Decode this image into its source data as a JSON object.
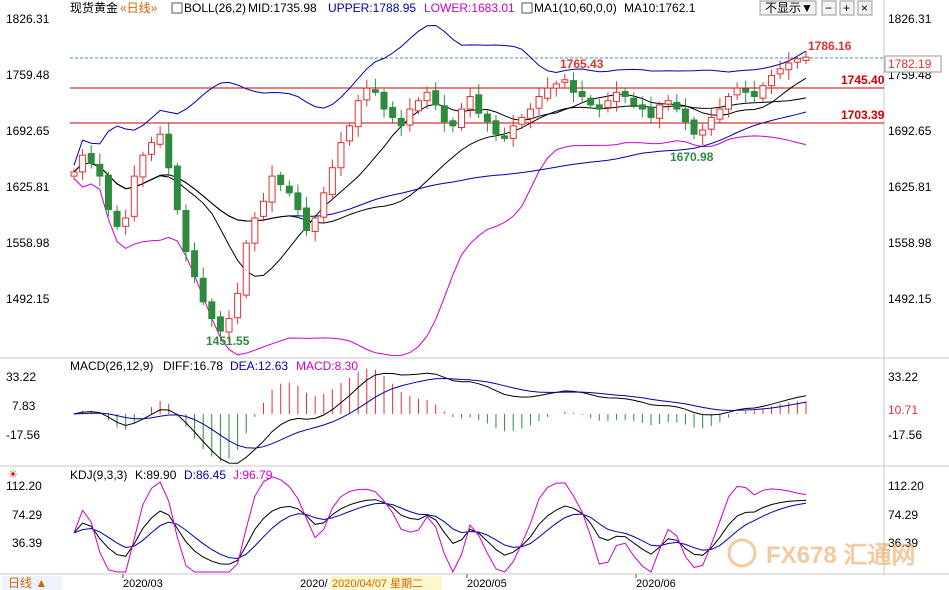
{
  "header": {
    "symbol": "现货黄金",
    "period": "«日线»",
    "boll_label": "BOLL(26,2)",
    "boll_mid": "MID:1735.98",
    "boll_upper": "UPPER:1788.95",
    "boll_lower": "LOWER:1683.01",
    "ma_label": "MA1(10,60,0,0)",
    "ma10": "MA10:1762.1",
    "hide_button": "不显示▼"
  },
  "price_axis": {
    "ticks": [
      "1826.31",
      "1759.48",
      "1692.65",
      "1625.81",
      "1558.98",
      "1492.15"
    ],
    "current_price": "1782.19"
  },
  "annotations": {
    "high_label": "1786.16",
    "peak_label": "1765.43",
    "resistance_1": "1745.40",
    "resistance_2": "1703.39",
    "trough_label": "1670.98",
    "low_label": "1451.55"
  },
  "macd": {
    "title": "MACD(26,12,9)",
    "diff": "DIFF:16.78",
    "dea": "DEA:12.63",
    "macd": "MACD:8.30",
    "ticks": [
      "33.22",
      "7.83",
      "-17.56"
    ],
    "current": "10.71"
  },
  "kdj": {
    "title": "KDJ(9,3,3)",
    "k": "K:89.90",
    "d": "D:86.45",
    "j": "J:96.79",
    "ticks": [
      "112.20",
      "74.29",
      "36.39"
    ]
  },
  "bottom_bar": {
    "period_button": "日线 ▲",
    "dates": [
      "2020/03",
      "2020/",
      "2020/04/07 星期二",
      "2020/05",
      "2020/06"
    ],
    "watermark": "FX678 汇通网"
  },
  "colors": {
    "up": "#e03131",
    "down": "#2e8b3e",
    "mid": "#000000",
    "upper": "#0000aa",
    "lower": "#cc00cc",
    "ma10": "#000000",
    "ma60": "#0000aa",
    "resistance": "#cc0000",
    "diff": "#000000",
    "dea": "#0000aa",
    "k": "#000000",
    "d": "#0000aa",
    "j": "#cc00cc"
  },
  "chart_data": {
    "type": "candlestick",
    "title": "现货黄金 日线",
    "price_range": [
      1440,
      1830
    ],
    "levels": [
      1745.4,
      1703.39,
      1786.16
    ],
    "closes": [
      1645,
      1665,
      1655,
      1640,
      1600,
      1580,
      1590,
      1640,
      1665,
      1680,
      1690,
      1650,
      1600,
      1550,
      1520,
      1490,
      1470,
      1455,
      1470,
      1500,
      1560,
      1590,
      1610,
      1640,
      1630,
      1620,
      1600,
      1575,
      1590,
      1620,
      1650,
      1680,
      1700,
      1730,
      1745,
      1740,
      1720,
      1710,
      1700,
      1720,
      1730,
      1740,
      1725,
      1705,
      1700,
      1720,
      1735,
      1715,
      1705,
      1690,
      1685,
      1700,
      1710,
      1720,
      1735,
      1745,
      1750,
      1755,
      1740,
      1735,
      1725,
      1720,
      1730,
      1740,
      1735,
      1725,
      1720,
      1710,
      1725,
      1730,
      1720,
      1705,
      1690,
      1695,
      1710,
      1720,
      1735,
      1745,
      1740,
      1735,
      1748,
      1760,
      1768,
      1775,
      1780,
      1782
    ]
  }
}
